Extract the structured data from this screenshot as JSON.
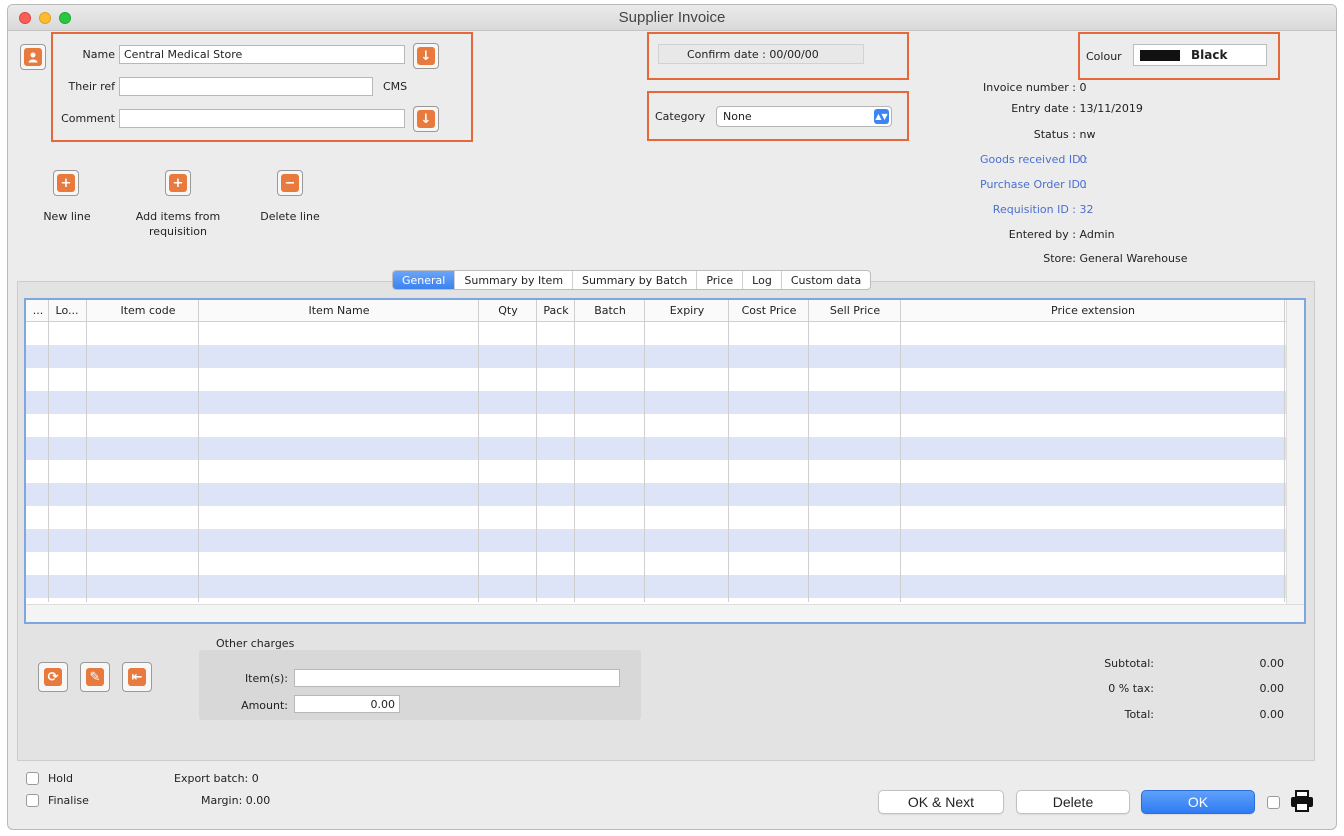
{
  "window": {
    "title": "Supplier Invoice"
  },
  "supplier": {
    "name_label": "Name",
    "name_value": "Central Medical Store",
    "their_ref_label": "Their ref",
    "their_ref_value": "",
    "their_ref_code": "CMS",
    "comment_label": "Comment",
    "comment_value": ""
  },
  "confirm": {
    "label": "Confirm date :",
    "value": "00/00/00"
  },
  "category": {
    "label": "Category",
    "value": "None"
  },
  "colour": {
    "label": "Colour",
    "value": "Black",
    "swatch": "#111111"
  },
  "info": [
    {
      "label": "Invoice number :",
      "value": "0",
      "link": false
    },
    {
      "label": "Entry date :",
      "value": "13/11/2019",
      "link": false
    },
    {
      "label": "Status :",
      "value": "nw",
      "link": false
    },
    {
      "label": "Goods received ID :",
      "value": "0",
      "link": true
    },
    {
      "label": "Purchase Order ID :",
      "value": "0",
      "link": true
    },
    {
      "label": "Requisition ID :",
      "value": "32",
      "link": true
    },
    {
      "label": "Entered by :",
      "value": "Admin",
      "link": false
    },
    {
      "label": "Store:",
      "value": "General Warehouse",
      "link": false
    }
  ],
  "actions": {
    "new_line": "New line",
    "add_items_1": "Add items from",
    "add_items_2": "requisition",
    "delete_line": "Delete line"
  },
  "tabs": [
    "General",
    "Summary by Item",
    "Summary by Batch",
    "Price",
    "Log",
    "Custom data"
  ],
  "table": {
    "columns": [
      "...",
      "Lo...",
      "Item code",
      "Item Name",
      "Qty",
      "Pack",
      "Batch",
      "Expiry",
      "Cost Price",
      "Sell Price",
      "Price extension"
    ]
  },
  "other_charges": {
    "title": "Other charges",
    "items_label": "Item(s):",
    "items_value": "",
    "amount_label": "Amount:",
    "amount_value": "0.00"
  },
  "totals": {
    "subtotal_label": "Subtotal:",
    "subtotal_value": "0.00",
    "tax_label": "0 % tax:",
    "tax_value": "0.00",
    "total_label": "Total:",
    "total_value": "0.00"
  },
  "footer": {
    "hold_label": "Hold",
    "finalise_label": "Finalise",
    "export_batch": "Export batch: 0",
    "margin": "Margin: 0.00",
    "ok_next": "OK & Next",
    "delete": "Delete",
    "ok": "OK"
  },
  "colors": {
    "highlight": "#e4683a",
    "accent": "#3a86f5"
  }
}
